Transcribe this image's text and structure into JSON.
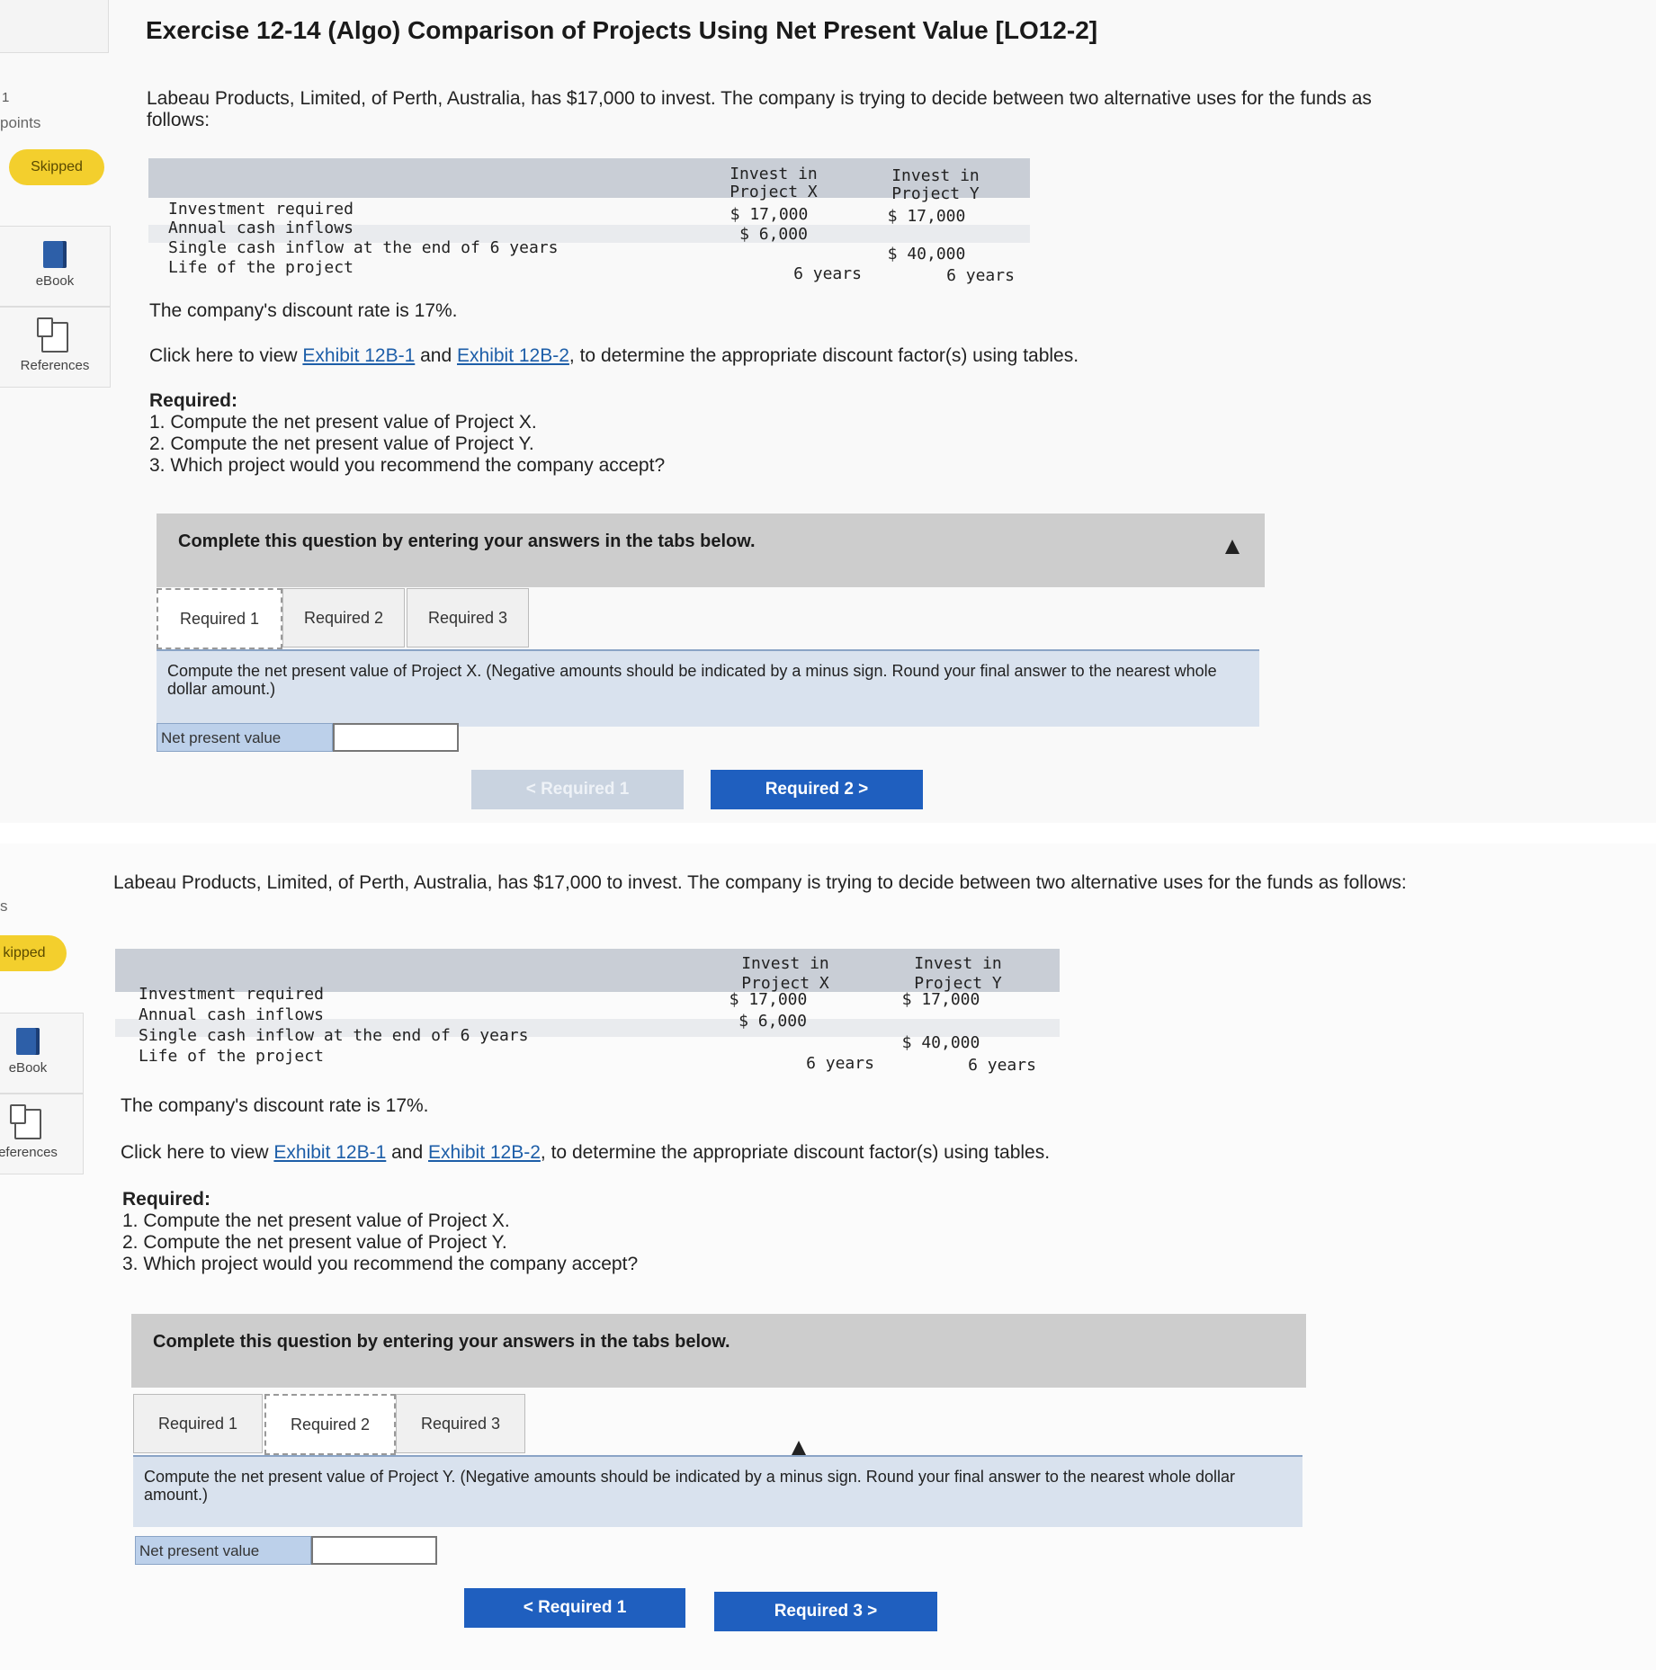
{
  "sidebar": {
    "points_num": "1",
    "points_label": "points",
    "status": "Skipped",
    "ebook": "eBook",
    "references": "References"
  },
  "sidebar_bottom": {
    "points_label": "s",
    "status": "kipped",
    "ebook": "eBook",
    "references": "eferences"
  },
  "exercise_title": "Exercise 12-14 (Algo) Comparison of Projects Using Net Present Value [LO12-2]",
  "intro": "Labeau Products, Limited, of Perth, Australia, has $17,000 to invest. The company is trying to decide between two alternative uses for the funds as follows:",
  "table": {
    "col_x": "Invest in Project X",
    "col_y": "Invest in Project Y",
    "rows": [
      {
        "label": "Investment required",
        "x": "$ 17,000",
        "y": "$ 17,000"
      },
      {
        "label": "Annual cash inflows",
        "x": "$ 6,000",
        "y": ""
      },
      {
        "label": "Single cash inflow at the end of 6 years",
        "x": "",
        "y": "$ 40,000"
      },
      {
        "label": "Life of the project",
        "x": "6 years",
        "y": "6 years"
      }
    ]
  },
  "discount_rate_text": "The company's discount rate is 17%.",
  "click_text": {
    "pre": "Click here to view ",
    "link1": "Exhibit 12B-1",
    "mid": " and ",
    "link2": "Exhibit 12B-2",
    "post": ", to determine the appropriate discount factor(s) using tables."
  },
  "required": {
    "heading": "Required:",
    "items": [
      "1. Compute the net present value of Project X.",
      "2. Compute the net present value of Project Y.",
      "3. Which project would you recommend the company accept?"
    ]
  },
  "banner": "Complete this question by entering your answers in the tabs below.",
  "tabs": [
    "Required 1",
    "Required 2",
    "Required 3"
  ],
  "panel1": {
    "instruction": "Compute the net present value of Project X. (Negative amounts should be indicated by a minus sign. Round your final answer to the nearest whole dollar amount.)",
    "field_label": "Net present value",
    "field_value": "",
    "prev_btn": "< Required 1",
    "next_btn": "Required 2 >"
  },
  "panel2": {
    "instruction": "Compute the net present value of Project Y. (Negative amounts should be indicated by a minus sign. Round your final answer to the nearest whole dollar amount.)",
    "field_label": "Net present value",
    "field_value": "",
    "prev_btn": "< Required 1",
    "next_btn": "Required 3 >"
  },
  "colors": {
    "accent_blue": "#1f5fbf",
    "skipped_yellow": "#f3cf2d",
    "link_blue": "#1d5ea8"
  }
}
